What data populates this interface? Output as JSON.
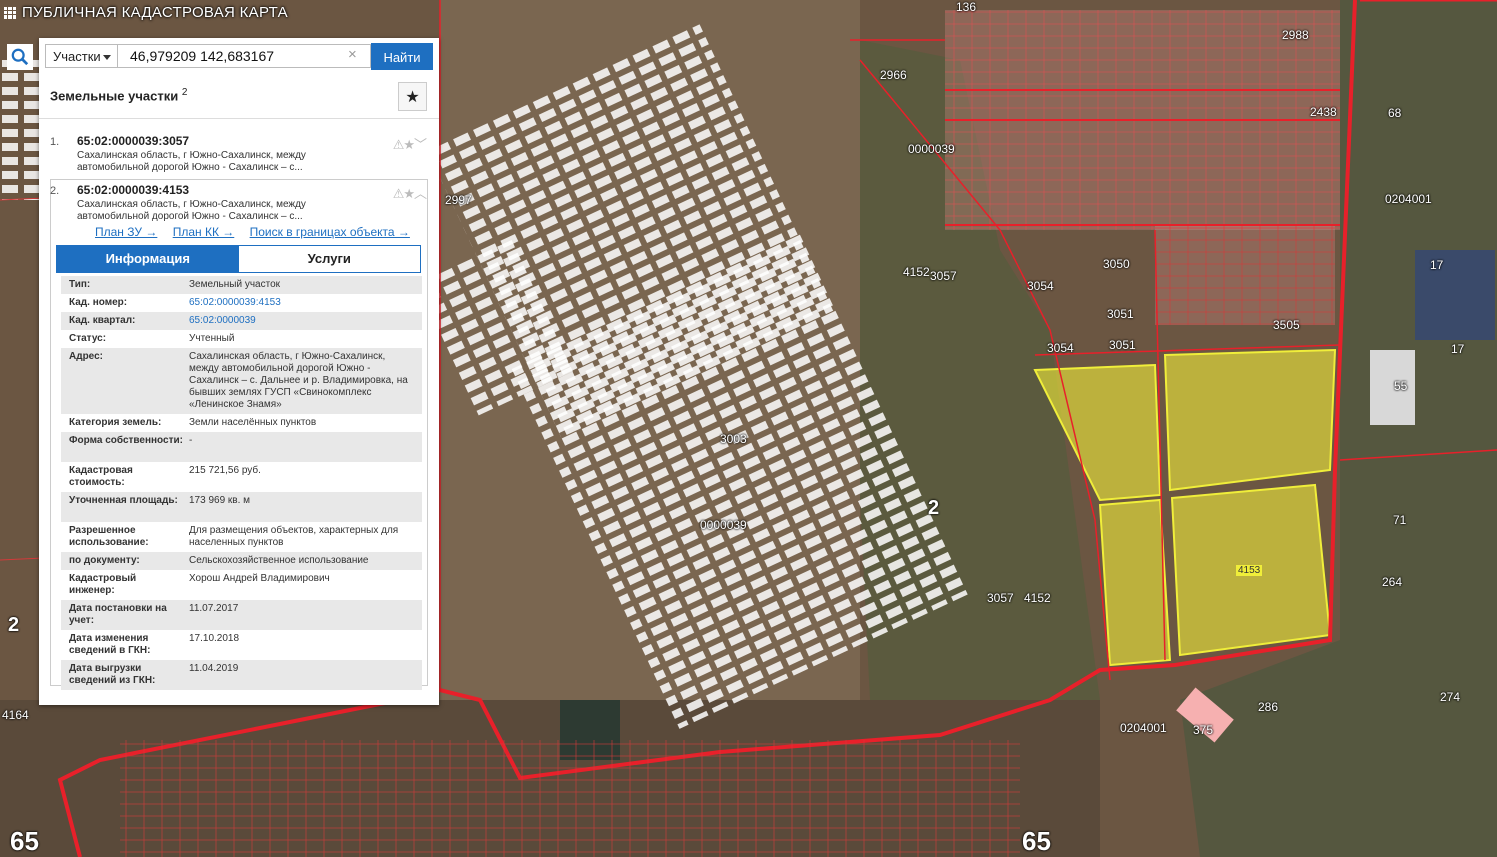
{
  "app": {
    "title": "ПУБЛИЧНАЯ КАДАСТРОВАЯ КАРТА"
  },
  "search": {
    "type_label": "Участки",
    "query": "46,979209 142,683167",
    "clear_icon": "×",
    "find_label": "Найти"
  },
  "results": {
    "header": "Земельные участки",
    "count": "2",
    "favorite_icon": "★",
    "items": [
      {
        "num": "1.",
        "cad": "65:02:0000039:3057",
        "address": "Сахалинская область, г Южно-Сахалинск, между автомобильной дорогой Южно - Сахалинск – с...",
        "icons": "⚠★﹀"
      },
      {
        "num": "2.",
        "cad": "65:02:0000039:4153",
        "address": "Сахалинская область, г Южно-Сахалинск, между автомобильной дорогой Южно - Сахалинск – с...",
        "icons": "⚠★︿"
      }
    ],
    "links": [
      "План ЗУ →",
      "План КК →",
      "Поиск в границах объекта →"
    ],
    "tabs": {
      "info": "Информация",
      "services": "Услуги"
    },
    "details": [
      {
        "k": "Тип:",
        "v": "Земельный участок"
      },
      {
        "k": "Кад. номер:",
        "v": "65:02:0000039:4153"
      },
      {
        "k": "Кад. квартал:",
        "v": "65:02:0000039"
      },
      {
        "k": "Статус:",
        "v": "Учтенный"
      },
      {
        "k": "Адрес:",
        "v": "Сахалинская область, г Южно-Сахалинск, между автомобильной дорогой Южно - Сахалинск – с. Дальнее и р. Владимировка, на бывших землях ГУСП «Свинокомплекс «Ленинское Знамя»"
      },
      {
        "k": "Категория земель:",
        "v": "Земли населённых пунктов"
      },
      {
        "k": "Форма собственности:",
        "v": "-"
      },
      {
        "k": "Кадастровая стоимость:",
        "v": "215 721,56 руб."
      },
      {
        "k": "Уточненная площадь:",
        "v": "173 969 кв. м"
      },
      {
        "k": "Разрешенное использование:",
        "v": "Для размещения объектов, характерных для населенных пунктов"
      },
      {
        "k": "по документу:",
        "v": "Сельскохозяйственное использование"
      },
      {
        "k": "Кадастровый инженер:",
        "v": "Хорош Андрей Владимирович"
      },
      {
        "k": "Дата постановки на учет:",
        "v": "11.07.2017"
      },
      {
        "k": "Дата изменения сведений в ГКН:",
        "v": "17.10.2018"
      },
      {
        "k": "Дата выгрузки сведений из ГКН:",
        "v": "11.04.2019"
      }
    ]
  },
  "map_labels": {
    "q39a": "0000039",
    "q39b": "0000039",
    "q4001a": "0204001",
    "q4001b": "0204001",
    "n65a": "65",
    "n65b": "65",
    "n2a": "2",
    "n2b": "2",
    "p4153": "4153",
    "p3057": "3057",
    "p4152": "4152",
    "p3057b": "3057",
    "p4152b": "4152",
    "p3054": "3054",
    "p3054b": "3054",
    "p3050": "3050",
    "p3051": "3051",
    "p3051b": "3051",
    "p3505": "3505",
    "p3003": "3003",
    "p2966": "2966",
    "p2997": "2997",
    "p2988": "2988",
    "p2438": "2438",
    "p136": "136",
    "p68": "68",
    "p17": "17",
    "p17b": "17",
    "p55": "55",
    "p71": "71",
    "p264": "264",
    "p286": "286",
    "p375": "375",
    "p274": "274",
    "p4164": "4164",
    "p4153hl": "4153"
  },
  "colors": {
    "accent": "#1e6fc1",
    "boundary": "#e8202a",
    "highlight": "#f0ee3a"
  }
}
